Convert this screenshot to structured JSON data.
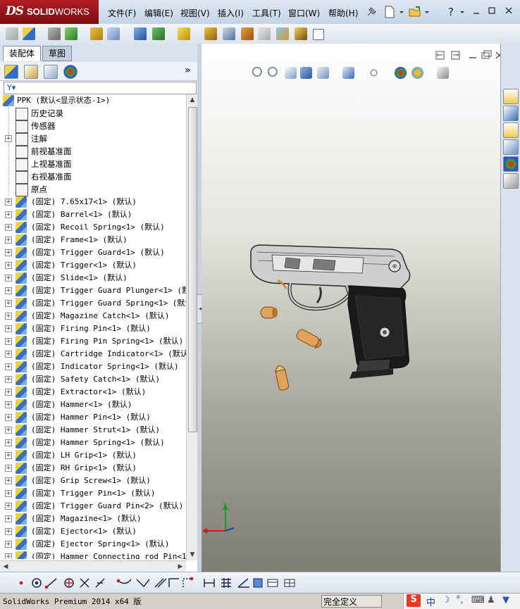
{
  "app": {
    "logo_ds": "DS",
    "logo_solid": "SOLID",
    "logo_works": "WORKS",
    "menu": [
      "文件(F)",
      "编辑(E)",
      "视图(V)",
      "插入(I)",
      "工具(T)",
      "窗口(W)",
      "帮助(H)"
    ]
  },
  "panel": {
    "tabs": [
      "装配体",
      "草图"
    ],
    "expand_glyph": "»",
    "filter_glyph": "Y▾"
  },
  "tree": {
    "root": "PPK  (默认<显示状态-1>)",
    "features": [
      {
        "label": "历史记录",
        "icon": "history-icon",
        "expandable": false
      },
      {
        "label": "传感器",
        "icon": "sensor-icon",
        "expandable": false
      },
      {
        "label": "注解",
        "icon": "annotation-icon",
        "expandable": true
      },
      {
        "label": "前视基准面",
        "icon": "plane-icon",
        "expandable": false
      },
      {
        "label": "上视基准面",
        "icon": "plane-icon",
        "expandable": false
      },
      {
        "label": "右视基准面",
        "icon": "plane-icon",
        "expandable": false
      },
      {
        "label": "原点",
        "icon": "origin-icon",
        "expandable": false
      }
    ],
    "parts": [
      "(固定) 7.65x17<1> (默认)",
      "(固定) Barrel<1> (默认)",
      "(固定) Recoil Spring<1> (默认)",
      "(固定) Frame<1> (默认)",
      "(固定) Trigger Guard<1> (默认)",
      "(固定) Trigger<1> (默认)",
      "(固定) Slide<1> (默认)",
      "(固定) Trigger Guard Plunger<1> (默认",
      "(固定) Trigger Guard Spring<1> (默认)",
      "(固定) Magazine Catch<1> (默认)",
      "(固定) Firing Pin<1> (默认)",
      "(固定) Firing Pin Spring<1> (默认)",
      "(固定) Cartridge Indicator<1> (默认)",
      "(固定) Indicator Spring<1> (默认)",
      "(固定) Safety Catch<1> (默认)",
      "(固定) Extractor<1> (默认)",
      "(固定) Hammer<1> (默认)",
      "(固定) Hammer Pin<1> (默认)",
      "(固定) Hammer Strut<1> (默认)",
      "(固定) Hammer Spring<1> (默认)",
      "(固定) LH Grip<1> (默认)",
      "(固定) RH Grip<1> (默认)",
      "(固定) Grip Screw<1> (默认)",
      "(固定) Trigger  Pin<1> (默认)",
      "(固定) Trigger Guard Pin<2> (默认)",
      "(固定) Magazine<1> (默认)",
      "(固定) Ejector<1> (默认)",
      "(固定) Ejector Spring<1> (默认)",
      "(固定) Hammer Connecting rod Pin<1>"
    ]
  },
  "status": {
    "left": "SolidWorks Premium 2014 x64 版",
    "state": "完全定义",
    "ime_lang": "中"
  },
  "colors": {
    "logo_red": "#b11c23",
    "brass": "#e0a35c",
    "triad_x": "#d01818",
    "triad_y": "#1a9a2a",
    "triad_z": "#1840d0"
  }
}
